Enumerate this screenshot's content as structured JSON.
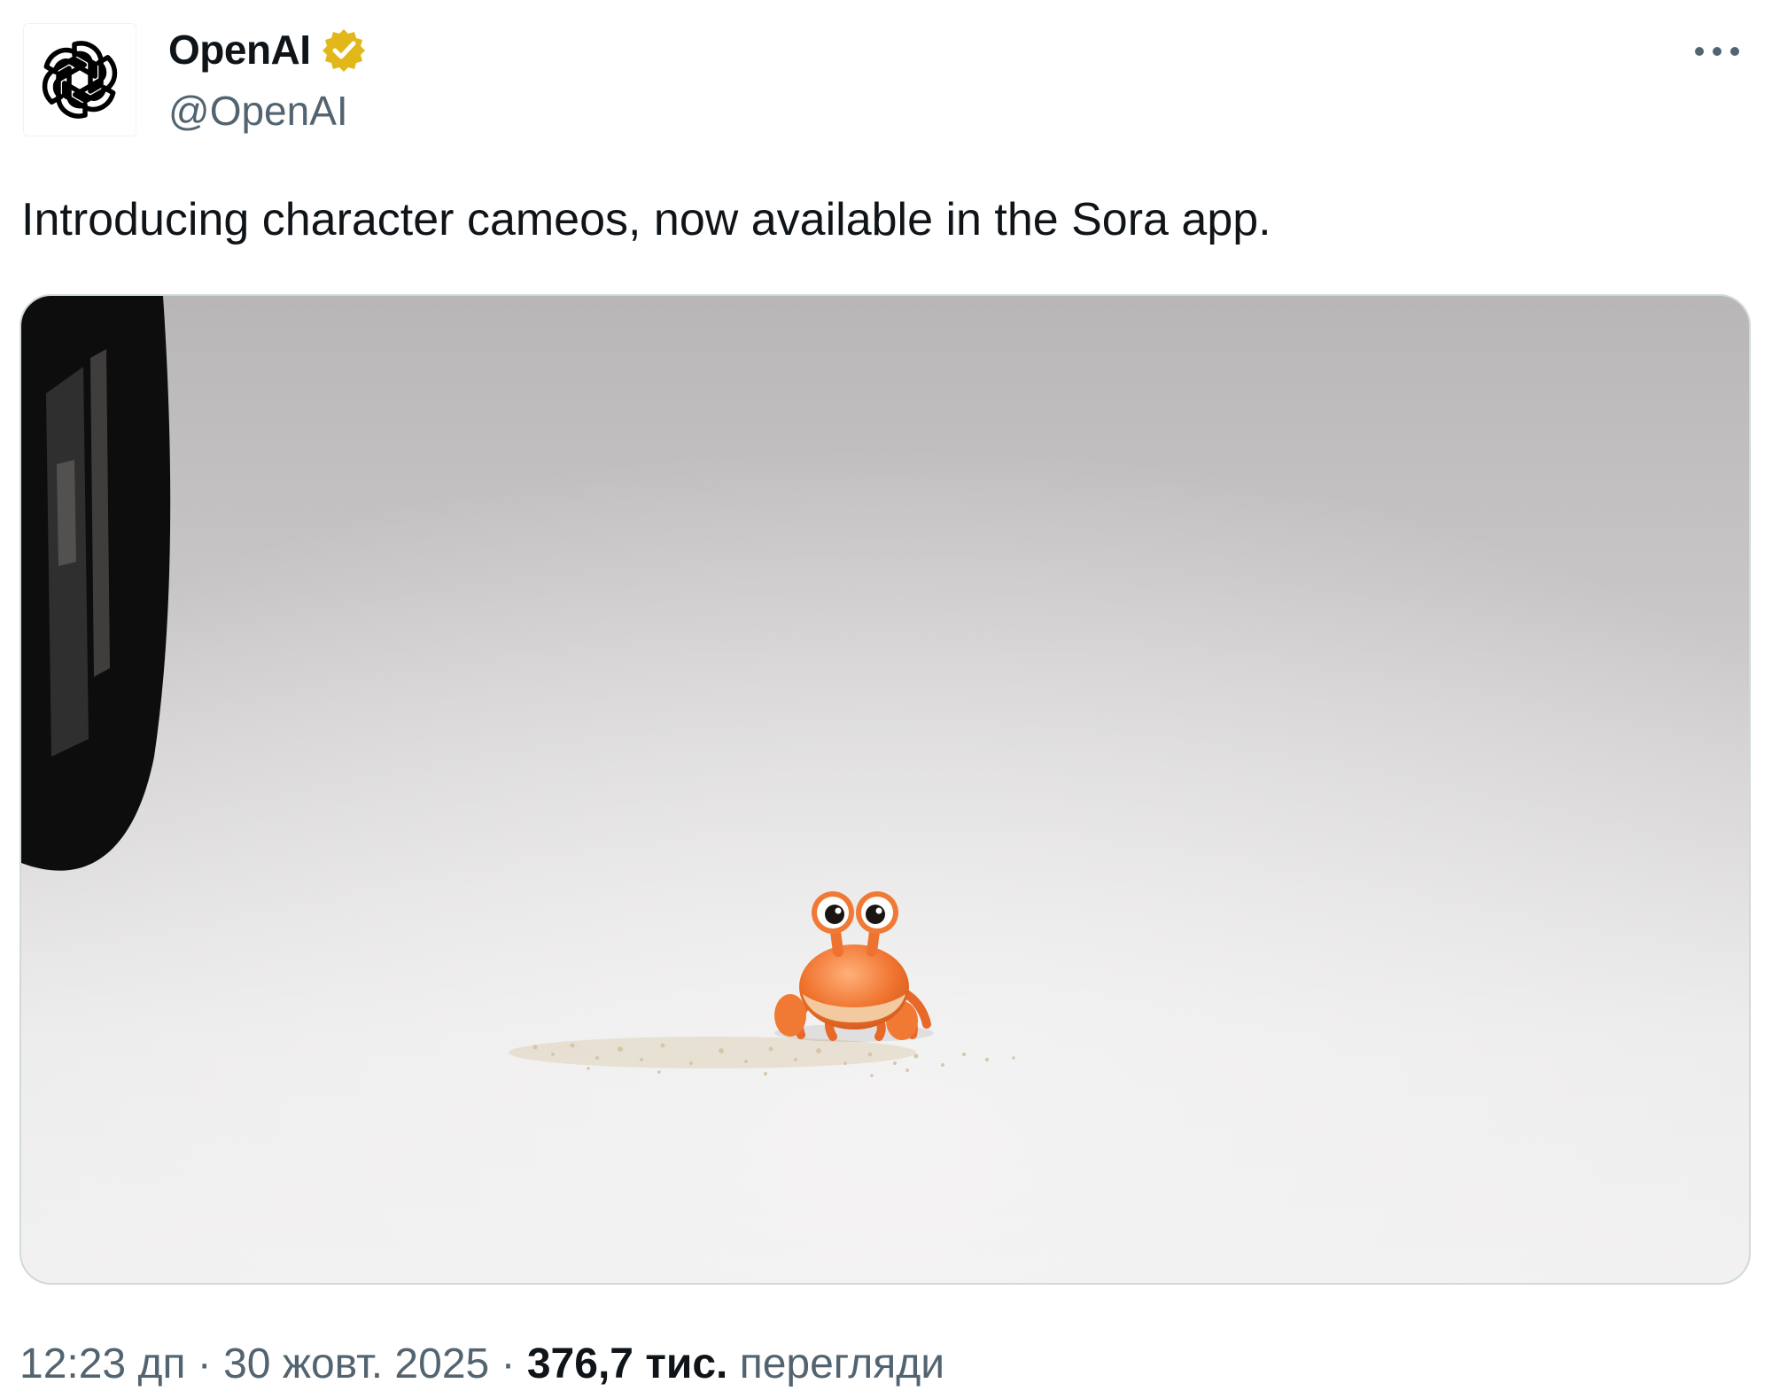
{
  "author": {
    "display_name": "OpenAI",
    "handle": "@OpenAI",
    "verified_icon": "verified-badge-icon",
    "verified_color": "#e2b719",
    "avatar_icon": "openai-logo-icon"
  },
  "more_icon": "more-options-icon",
  "tweet": {
    "text": "Introducing character cameos, now available in the Sora app."
  },
  "media": {
    "type": "video-thumbnail",
    "subject_icon": "crab-character-icon"
  },
  "meta": {
    "time": "12:23 дп",
    "separator": " · ",
    "date": "30 жовт. 2025",
    "views_count": "376,7 тис.",
    "views_label": "перегляди"
  },
  "colors": {
    "text_primary": "#0f1419",
    "text_secondary": "#536471",
    "border": "#cfd9de"
  }
}
